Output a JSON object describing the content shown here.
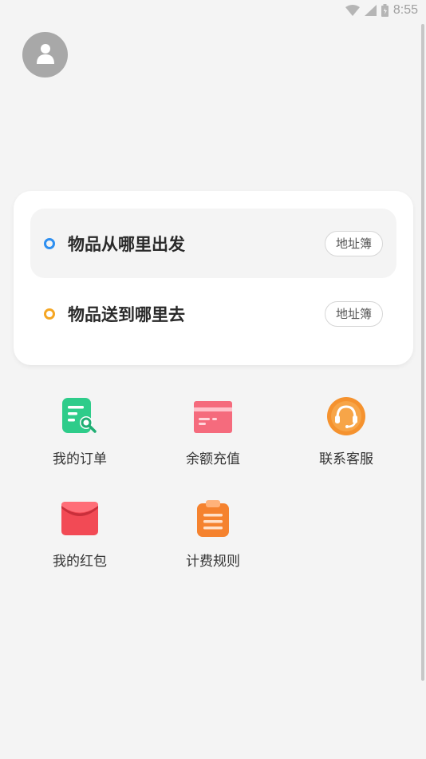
{
  "status_bar": {
    "time": "8:55",
    "icons": [
      "wifi-icon",
      "signal-icon",
      "battery-icon"
    ]
  },
  "avatar": {
    "icon": "user-icon"
  },
  "address": {
    "from": {
      "label": "物品从哪里出发",
      "book": "地址簿",
      "color": "#2e8ff0"
    },
    "to": {
      "label": "物品送到哪里去",
      "book": "地址簿",
      "color": "#f5a623"
    }
  },
  "features": [
    {
      "label": "我的订单",
      "icon": "order-search-icon",
      "color": "#2ecc8a"
    },
    {
      "label": "余额充值",
      "icon": "card-icon",
      "color": "#f56b7d"
    },
    {
      "label": "联系客服",
      "icon": "headset-icon",
      "color": "#f5922e"
    },
    {
      "label": "我的红包",
      "icon": "red-packet-icon",
      "color": "#f24a55"
    },
    {
      "label": "计费规则",
      "icon": "clipboard-icon",
      "color": "#f5822e"
    }
  ]
}
